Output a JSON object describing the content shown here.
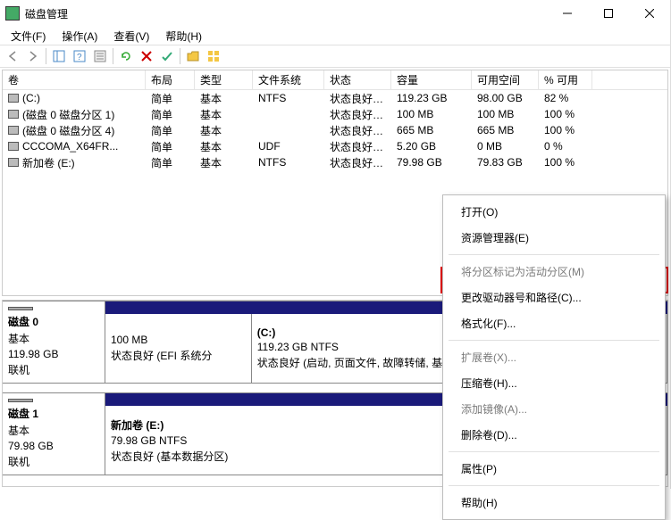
{
  "title": "磁盘管理",
  "menu": {
    "file": "文件(F)",
    "action": "操作(A)",
    "view": "查看(V)",
    "help": "帮助(H)"
  },
  "columns": {
    "c0": "卷",
    "c1": "布局",
    "c2": "类型",
    "c3": "文件系统",
    "c4": "状态",
    "c5": "容量",
    "c6": "可用空间",
    "c7": "% 可用"
  },
  "volumes": [
    {
      "name": "(C:)",
      "layout": "简单",
      "type": "基本",
      "fs": "NTFS",
      "status": "状态良好 (...",
      "cap": "119.23 GB",
      "free": "98.00 GB",
      "pct": "82 %"
    },
    {
      "name": "(磁盘 0 磁盘分区 1)",
      "layout": "简单",
      "type": "基本",
      "fs": "",
      "status": "状态良好 (...",
      "cap": "100 MB",
      "free": "100 MB",
      "pct": "100 %"
    },
    {
      "name": "(磁盘 0 磁盘分区 4)",
      "layout": "简单",
      "type": "基本",
      "fs": "",
      "status": "状态良好 (...",
      "cap": "665 MB",
      "free": "665 MB",
      "pct": "100 %"
    },
    {
      "name": "CCCOMA_X64FR...",
      "layout": "简单",
      "type": "基本",
      "fs": "UDF",
      "status": "状态良好 (...",
      "cap": "5.20 GB",
      "free": "0 MB",
      "pct": "0 %"
    },
    {
      "name": "新加卷 (E:)",
      "layout": "简单",
      "type": "基本",
      "fs": "NTFS",
      "status": "状态良好 (...",
      "cap": "79.98 GB",
      "free": "79.83 GB",
      "pct": "100 %"
    }
  ],
  "disks": [
    {
      "label": "磁盘 0",
      "type": "基本",
      "size": "119.98 GB",
      "status": "联机",
      "parts": [
        {
          "name": "",
          "sub": "100 MB",
          "desc": "状态良好 (EFI 系统分",
          "flex": 1
        },
        {
          "name": "(C:)",
          "sub": "119.23 GB NTFS",
          "desc": "状态良好 (启动, 页面文件, 故障转储, 基本数",
          "flex": 3
        }
      ]
    },
    {
      "label": "磁盘 1",
      "type": "基本",
      "size": "79.98 GB",
      "status": "联机",
      "parts": [
        {
          "name": "新加卷  (E:)",
          "sub": "79.98 GB NTFS",
          "desc": "状态良好 (基本数据分区)",
          "flex": 1
        }
      ]
    }
  ],
  "ctx": {
    "open": "打开(O)",
    "explorer": "资源管理器(E)",
    "mark_active": "将分区标记为活动分区(M)",
    "change_letter": "更改驱动器号和路径(C)...",
    "format": "格式化(F)...",
    "extend": "扩展卷(X)...",
    "shrink": "压缩卷(H)...",
    "mirror": "添加镜像(A)...",
    "delete": "删除卷(D)...",
    "properties": "属性(P)",
    "help": "帮助(H)"
  }
}
